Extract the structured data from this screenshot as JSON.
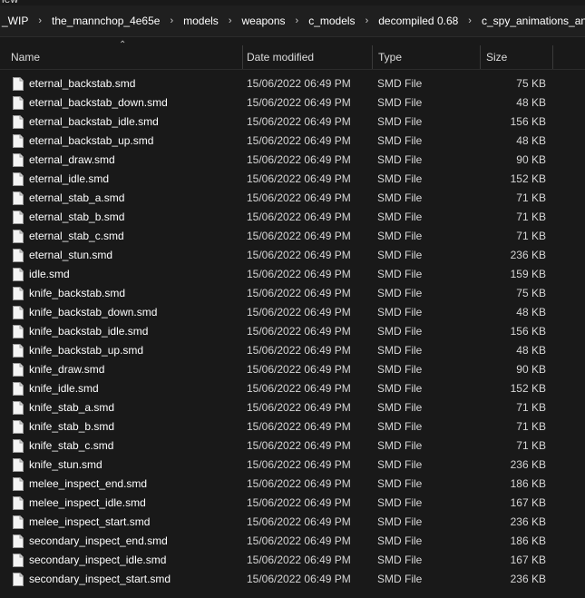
{
  "top_fragment": "iew",
  "breadcrumbs": [
    "_WIP",
    "the_mannchop_4e65e",
    "models",
    "weapons",
    "c_models",
    "decompiled 0.68",
    "c_spy_animations_anims"
  ],
  "columns": {
    "name": "Name",
    "date": "Date modified",
    "type": "Type",
    "size": "Size"
  },
  "files": [
    {
      "name": "eternal_backstab.smd",
      "date": "15/06/2022 06:49 PM",
      "type": "SMD File",
      "size": "75 KB"
    },
    {
      "name": "eternal_backstab_down.smd",
      "date": "15/06/2022 06:49 PM",
      "type": "SMD File",
      "size": "48 KB"
    },
    {
      "name": "eternal_backstab_idle.smd",
      "date": "15/06/2022 06:49 PM",
      "type": "SMD File",
      "size": "156 KB"
    },
    {
      "name": "eternal_backstab_up.smd",
      "date": "15/06/2022 06:49 PM",
      "type": "SMD File",
      "size": "48 KB"
    },
    {
      "name": "eternal_draw.smd",
      "date": "15/06/2022 06:49 PM",
      "type": "SMD File",
      "size": "90 KB"
    },
    {
      "name": "eternal_idle.smd",
      "date": "15/06/2022 06:49 PM",
      "type": "SMD File",
      "size": "152 KB"
    },
    {
      "name": "eternal_stab_a.smd",
      "date": "15/06/2022 06:49 PM",
      "type": "SMD File",
      "size": "71 KB"
    },
    {
      "name": "eternal_stab_b.smd",
      "date": "15/06/2022 06:49 PM",
      "type": "SMD File",
      "size": "71 KB"
    },
    {
      "name": "eternal_stab_c.smd",
      "date": "15/06/2022 06:49 PM",
      "type": "SMD File",
      "size": "71 KB"
    },
    {
      "name": "eternal_stun.smd",
      "date": "15/06/2022 06:49 PM",
      "type": "SMD File",
      "size": "236 KB"
    },
    {
      "name": "idle.smd",
      "date": "15/06/2022 06:49 PM",
      "type": "SMD File",
      "size": "159 KB"
    },
    {
      "name": "knife_backstab.smd",
      "date": "15/06/2022 06:49 PM",
      "type": "SMD File",
      "size": "75 KB"
    },
    {
      "name": "knife_backstab_down.smd",
      "date": "15/06/2022 06:49 PM",
      "type": "SMD File",
      "size": "48 KB"
    },
    {
      "name": "knife_backstab_idle.smd",
      "date": "15/06/2022 06:49 PM",
      "type": "SMD File",
      "size": "156 KB"
    },
    {
      "name": "knife_backstab_up.smd",
      "date": "15/06/2022 06:49 PM",
      "type": "SMD File",
      "size": "48 KB"
    },
    {
      "name": "knife_draw.smd",
      "date": "15/06/2022 06:49 PM",
      "type": "SMD File",
      "size": "90 KB"
    },
    {
      "name": "knife_idle.smd",
      "date": "15/06/2022 06:49 PM",
      "type": "SMD File",
      "size": "152 KB"
    },
    {
      "name": "knife_stab_a.smd",
      "date": "15/06/2022 06:49 PM",
      "type": "SMD File",
      "size": "71 KB"
    },
    {
      "name": "knife_stab_b.smd",
      "date": "15/06/2022 06:49 PM",
      "type": "SMD File",
      "size": "71 KB"
    },
    {
      "name": "knife_stab_c.smd",
      "date": "15/06/2022 06:49 PM",
      "type": "SMD File",
      "size": "71 KB"
    },
    {
      "name": "knife_stun.smd",
      "date": "15/06/2022 06:49 PM",
      "type": "SMD File",
      "size": "236 KB"
    },
    {
      "name": "melee_inspect_end.smd",
      "date": "15/06/2022 06:49 PM",
      "type": "SMD File",
      "size": "186 KB"
    },
    {
      "name": "melee_inspect_idle.smd",
      "date": "15/06/2022 06:49 PM",
      "type": "SMD File",
      "size": "167 KB"
    },
    {
      "name": "melee_inspect_start.smd",
      "date": "15/06/2022 06:49 PM",
      "type": "SMD File",
      "size": "236 KB"
    },
    {
      "name": "secondary_inspect_end.smd",
      "date": "15/06/2022 06:49 PM",
      "type": "SMD File",
      "size": "186 KB"
    },
    {
      "name": "secondary_inspect_idle.smd",
      "date": "15/06/2022 06:49 PM",
      "type": "SMD File",
      "size": "167 KB"
    },
    {
      "name": "secondary_inspect_start.smd",
      "date": "15/06/2022 06:49 PM",
      "type": "SMD File",
      "size": "236 KB"
    }
  ],
  "icons": {
    "breadcrumb_separator": "chevron-right-icon",
    "file": "file-icon",
    "sort": "sort-ascending-icon"
  },
  "colors": {
    "background": "#191919",
    "text": "#ffffff",
    "secondary_text": "#d6d6d6"
  }
}
